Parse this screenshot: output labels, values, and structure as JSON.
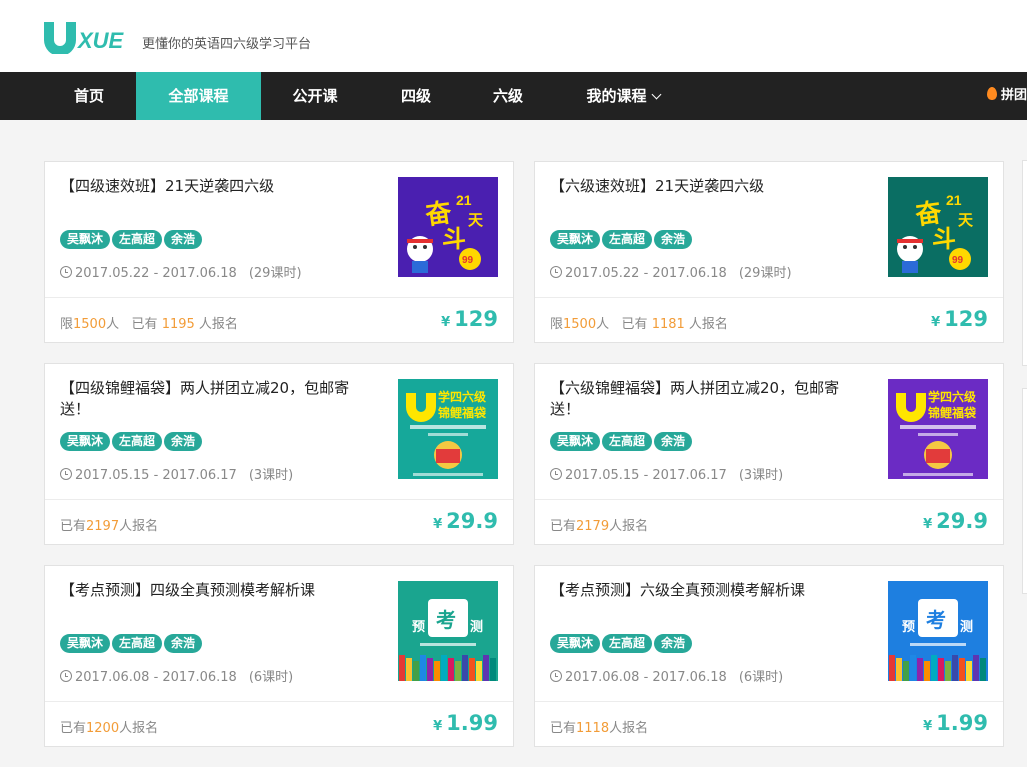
{
  "brand": {
    "logo_text": "UXUE",
    "slogan": "更懂你的英语四六级学习平台"
  },
  "nav": {
    "items": [
      {
        "label": "首页",
        "active": false
      },
      {
        "label": "全部课程",
        "active": true
      },
      {
        "label": "公开课",
        "active": false
      },
      {
        "label": "四级",
        "active": false
      },
      {
        "label": "六级",
        "active": false
      },
      {
        "label": "我的课程",
        "active": false
      }
    ],
    "right_label": "拼团"
  },
  "currency": "¥",
  "labels": {
    "limit_prefix": "限",
    "person_unit": "人",
    "have_prefix": "已有",
    "enrolled_suffix": "人报名"
  },
  "courses": [
    {
      "title": "【四级速效班】21天逆袭四六级",
      "teachers": [
        "吴飘沐",
        "左高超",
        "余浩"
      ],
      "date_range": "2017.05.22 - 2017.06.18",
      "lessons": "(29课时)",
      "limit": "1500",
      "enrolled": "1195",
      "price": "129",
      "thumb": "fendou",
      "thumb_bg": "#4a1fb0"
    },
    {
      "title": "【六级速效班】21天逆袭四六级",
      "teachers": [
        "吴飘沐",
        "左高超",
        "余浩"
      ],
      "date_range": "2017.05.22 - 2017.06.18",
      "lessons": "(29课时)",
      "limit": "1500",
      "enrolled": "1181",
      "price": "129",
      "thumb": "fendou",
      "thumb_bg": "#0a6e63"
    },
    {
      "title": "【四级锦鲤福袋】两人拼团立减20，包邮寄送！",
      "teachers": [
        "吴飘沐",
        "左高超",
        "余浩"
      ],
      "date_range": "2017.05.15 - 2017.06.17",
      "lessons": "(3课时)",
      "enrolled": "2197",
      "price": "29.9",
      "thumb": "jinli",
      "thumb_bg": "#16a89a"
    },
    {
      "title": "【六级锦鲤福袋】两人拼团立减20，包邮寄送！",
      "teachers": [
        "吴飘沐",
        "左高超",
        "余浩"
      ],
      "date_range": "2017.05.15 - 2017.06.17",
      "lessons": "(3课时)",
      "enrolled": "2179",
      "price": "29.9",
      "thumb": "jinli",
      "thumb_bg": "#6b2bc4"
    },
    {
      "title": "【考点预测】四级全真预测模考解析课",
      "teachers": [
        "吴飘沐",
        "左高超",
        "余浩"
      ],
      "date_range": "2017.06.08 - 2017.06.18",
      "lessons": "(6课时)",
      "enrolled": "1200",
      "price": "1.99",
      "thumb": "yuce",
      "thumb_bg": "#1aa58f"
    },
    {
      "title": "【考点预测】六级全真预测模考解析课",
      "teachers": [
        "吴飘沐",
        "左高超",
        "余浩"
      ],
      "date_range": "2017.06.08 - 2017.06.18",
      "lessons": "(6课时)",
      "enrolled": "1118",
      "price": "1.99",
      "thumb": "yuce",
      "thumb_bg": "#1e7fe0"
    }
  ]
}
